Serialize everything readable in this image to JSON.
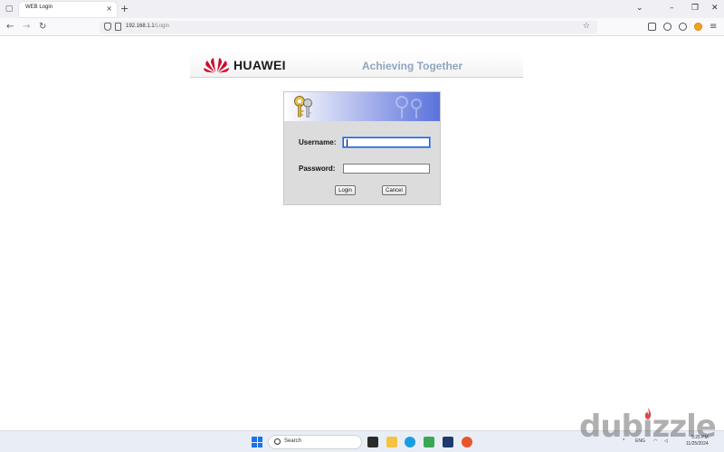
{
  "browser": {
    "tab_title": "WEB Login",
    "tab_close": "×",
    "new_tab": "+",
    "url_host": "192.168.1.1",
    "url_path": "/Login",
    "window_controls": [
      "⌄",
      "–",
      "❐",
      "✕"
    ]
  },
  "page": {
    "brand": "HUAWEI",
    "tagline": "Achieving Together",
    "username_label": "Username:",
    "password_label": "Password:",
    "username_value": "",
    "password_value": "",
    "login_button": "Login",
    "cancel_button": "Cancel"
  },
  "taskbar": {
    "search_placeholder": "Search",
    "lang": "ENG",
    "time": "5:25 PM",
    "date": "11/25/2024"
  },
  "watermark": "dubizzle",
  "colors": {
    "huawei_red": "#cf0a2c",
    "tagline": "#8fa6bf",
    "login_bg": "#dcdcdc",
    "header_gradient_end": "#5a72dc",
    "focus_blue": "#1d5bd4"
  }
}
